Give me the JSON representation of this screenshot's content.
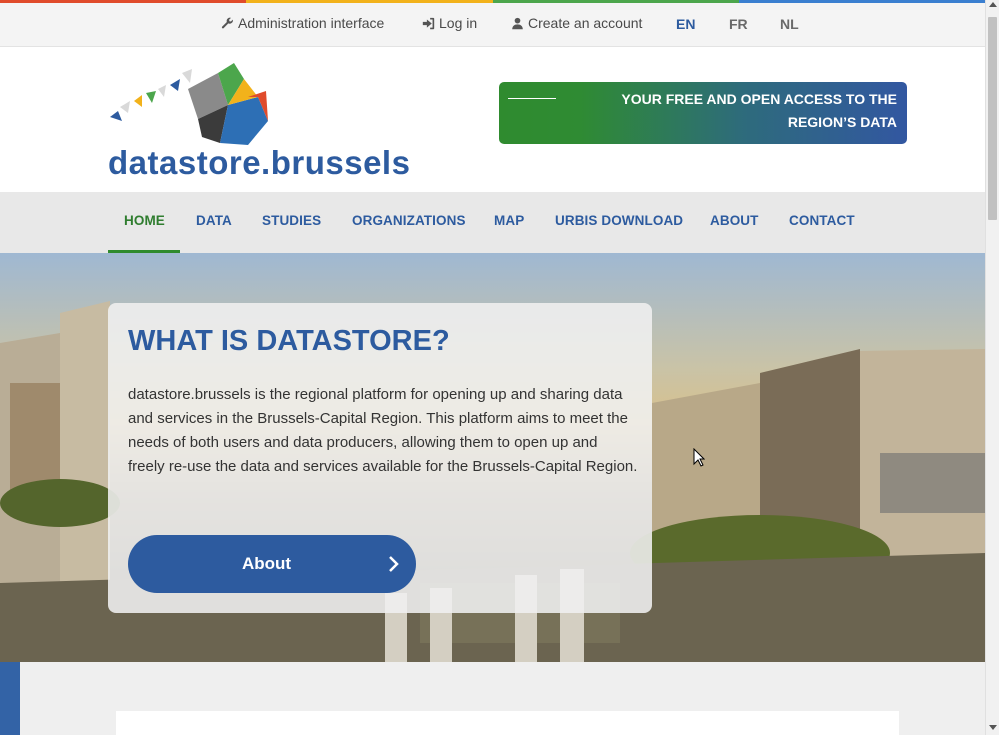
{
  "colors": {
    "brand_blue": "#2d5b9f",
    "brand_green": "#2f8b2f",
    "top_stripe": [
      "#e04b2b",
      "#f2b21b",
      "#4ca64c",
      "#3a7fd0"
    ]
  },
  "utility_bar": {
    "admin_label": "Administration interface",
    "admin_icon": "wrench-icon",
    "login_label": "Log in",
    "login_icon": "sign-in-icon",
    "create_account_label": "Create an account",
    "create_account_icon": "user-icon",
    "languages": [
      "EN",
      "FR",
      "NL"
    ],
    "active_language": "EN"
  },
  "header": {
    "logo_text": "datastore.brussels",
    "tagline": "YOUR FREE AND OPEN ACCESS TO THE REGION’S DATA"
  },
  "nav": {
    "items": [
      "HOME",
      "DATA",
      "STUDIES",
      "ORGANIZATIONS",
      "MAP",
      "URBIS DOWNLOAD",
      "ABOUT",
      "CONTACT"
    ],
    "active": "HOME"
  },
  "hero": {
    "title": "WHAT IS DATASTORE?",
    "description": "datastore.brussels is the regional platform for opening up and sharing data and services in the Brussels-Capital Region. This platform aims to meet the needs of both users and data producers, allowing them to open up and freely re-use the data and services available for the Brussels-Capital Region.",
    "button_label": "About",
    "button_icon": "chevron-right-icon"
  }
}
